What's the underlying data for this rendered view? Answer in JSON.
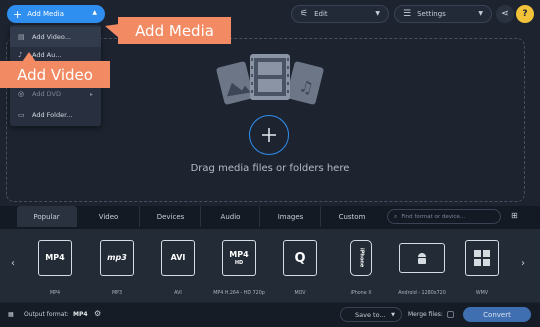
{
  "toolbar": {
    "add_media_label": "Add Media",
    "edit_label": "Edit",
    "settings_label": "Settings"
  },
  "menu": {
    "items": [
      {
        "label": "Add Video...",
        "icon": "film-icon"
      },
      {
        "label": "Add Au...",
        "icon": "music-note-icon"
      },
      {
        "label": "",
        "icon": "image-icon"
      },
      {
        "label": "Add DVD",
        "icon": "disc-icon"
      },
      {
        "label": "Add Folder...",
        "icon": "folder-icon"
      }
    ]
  },
  "callouts": {
    "add_media": "Add Media",
    "add_video": "Add Video"
  },
  "drop_area": {
    "text": "Drag media files or folders here"
  },
  "tabs": [
    "Popular",
    "Video",
    "Devices",
    "Audio",
    "Images",
    "Custom"
  ],
  "active_tab": "Popular",
  "format_search": {
    "placeholder": "Find format or device..."
  },
  "formats": [
    {
      "label": "MP4",
      "icon_text": "MP4",
      "icon_sub": ""
    },
    {
      "label": "MP3",
      "icon_text": "mp3",
      "icon_sub": ""
    },
    {
      "label": "AVI",
      "icon_text": "AVI",
      "icon_sub": ""
    },
    {
      "label": "MP4 H.264 - HD 720p",
      "icon_text": "MP4",
      "icon_sub": "HD"
    },
    {
      "label": "MOV",
      "icon_text": "Q",
      "icon_sub": ""
    },
    {
      "label": "iPhone X",
      "icon_text": "iPhone",
      "icon_sub": ""
    },
    {
      "label": "Android - 1280x720",
      "icon_text": "",
      "icon_sub": ""
    },
    {
      "label": "WMV",
      "icon_text": "",
      "icon_sub": ""
    }
  ],
  "bottom": {
    "output_label": "Output format:",
    "output_value": "MP4",
    "save_label": "Save to...",
    "merge_label": "Merge files:",
    "convert_label": "Convert"
  },
  "colors": {
    "accent": "#2f8ff0",
    "callout": "#f28a63",
    "background": "#1d2430"
  }
}
